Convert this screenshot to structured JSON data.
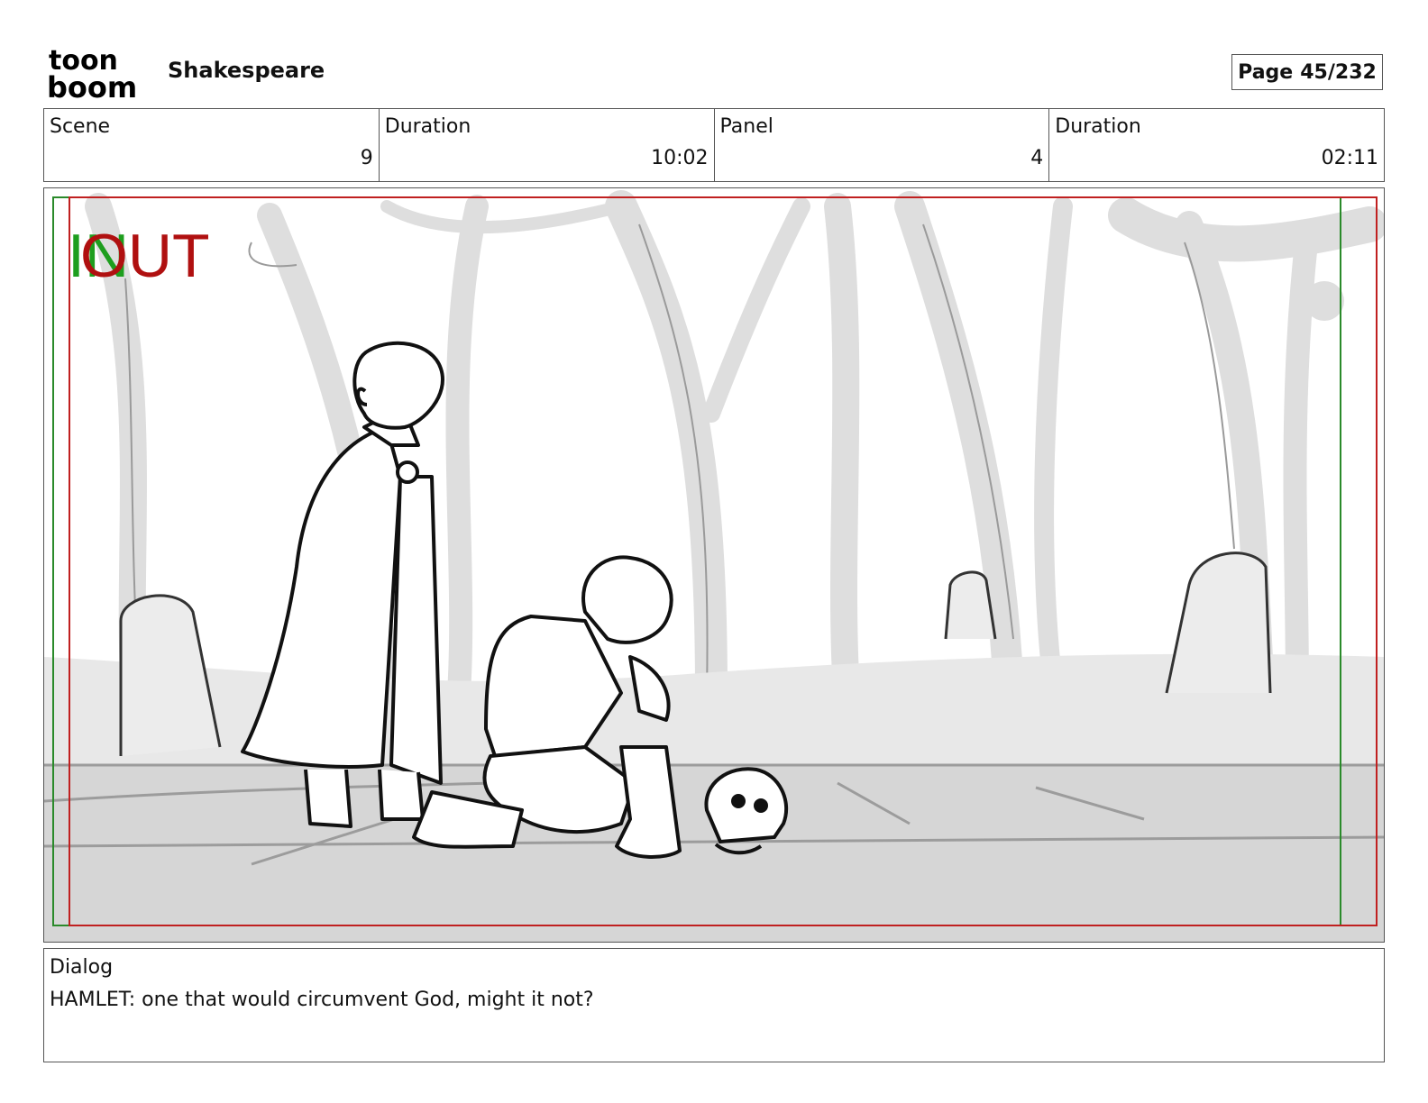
{
  "header": {
    "logo_line1": "toon",
    "logo_line2": "boom",
    "project_title": "Shakespeare",
    "page_label": "Page",
    "page_value": "45/232"
  },
  "info": {
    "scene_label": "Scene",
    "scene_value": "9",
    "scene_duration_label": "Duration",
    "scene_duration_value": "10:02",
    "panel_label": "Panel",
    "panel_value": "4",
    "panel_duration_label": "Duration",
    "panel_duration_value": "02:11"
  },
  "panel": {
    "in_label": "IN",
    "out_label": "OUT",
    "in_color": "#1e9e1e",
    "out_color": "#b01010"
  },
  "dialog": {
    "label": "Dialog",
    "text": "HAMLET: one that would circumvent God, might it not?"
  }
}
